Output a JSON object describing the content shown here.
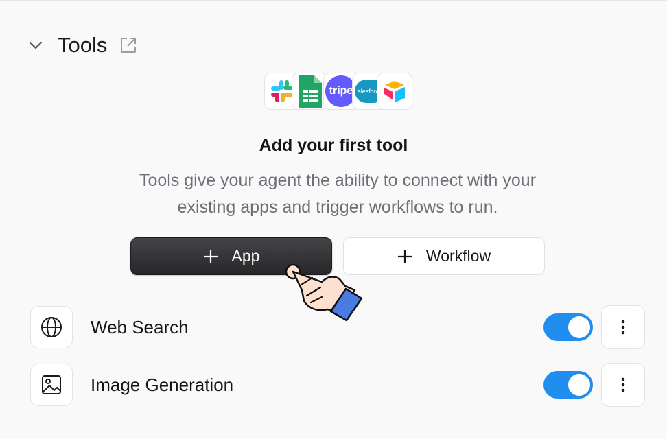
{
  "section": {
    "title": "Tools",
    "collapse_icon": "chevron-down-icon",
    "external_icon": "external-link-icon"
  },
  "logos": [
    {
      "name": "slack",
      "label": ""
    },
    {
      "name": "google-sheets",
      "label": ""
    },
    {
      "name": "stripe",
      "label": "tripe"
    },
    {
      "name": "salesforce",
      "label": "alesforce"
    },
    {
      "name": "airtable",
      "label": ""
    }
  ],
  "empty_state": {
    "title": "Add your first tool",
    "description": "Tools give your agent the ability to connect with your existing apps and trigger workflows to run."
  },
  "buttons": {
    "app": "App",
    "workflow": "Workflow"
  },
  "tools": [
    {
      "label": "Web Search",
      "icon": "globe-icon",
      "enabled": true
    },
    {
      "label": "Image Generation",
      "icon": "image-icon",
      "enabled": true
    }
  ],
  "colors": {
    "toggle_on": "#1f8eef",
    "app_button": "#2d2d30"
  }
}
